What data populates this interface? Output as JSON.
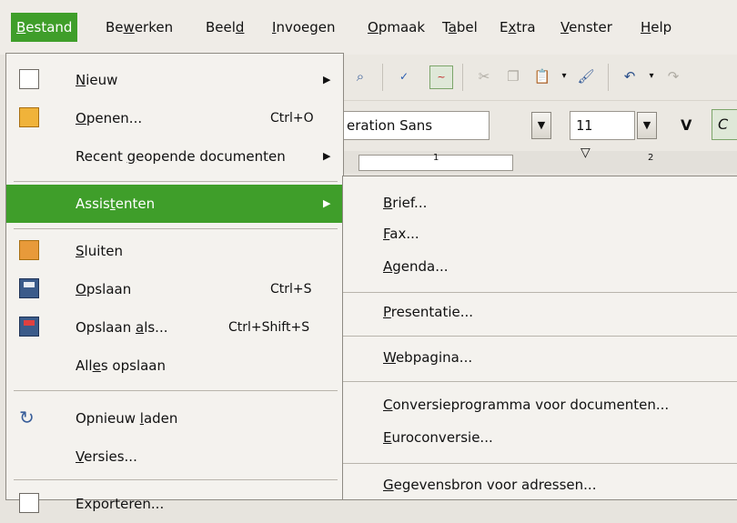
{
  "menubar": {
    "items": [
      {
        "label": "Bestand"
      },
      {
        "label": "Bewerken"
      },
      {
        "label": "Beeld"
      },
      {
        "label": "Invoegen"
      },
      {
        "label": "Opmaak"
      },
      {
        "label": "Tabel"
      },
      {
        "label": "Extra"
      },
      {
        "label": "Venster"
      },
      {
        "label": "Help"
      }
    ]
  },
  "toolbar": {
    "font_name": "eration Sans",
    "font_size": "11",
    "bold_label": "V",
    "italic_label": "C",
    "ruler_marks": [
      "1",
      "2"
    ]
  },
  "file_menu": {
    "items": [
      {
        "label": "Nieuw",
        "shortcut": "",
        "icon": "new-document-icon"
      },
      {
        "label": "Openen...",
        "shortcut": "Ctrl+O",
        "icon": "open-folder-icon"
      },
      {
        "label": "Recent geopende documenten",
        "shortcut": "",
        "icon": ""
      },
      {
        "label": "Assistenten",
        "shortcut": "",
        "icon": ""
      },
      {
        "label": "Sluiten",
        "shortcut": "",
        "icon": "close-document-icon"
      },
      {
        "label": "Opslaan",
        "shortcut": "Ctrl+S",
        "icon": "save-icon"
      },
      {
        "label": "Opslaan als...",
        "shortcut": "Ctrl+Shift+S",
        "icon": "save-as-icon"
      },
      {
        "label": "Alles opslaan",
        "shortcut": "",
        "icon": ""
      },
      {
        "label": "Opnieuw laden",
        "shortcut": "",
        "icon": "reload-icon"
      },
      {
        "label": "Versies...",
        "shortcut": "",
        "icon": ""
      },
      {
        "label": "Exporteren...",
        "shortcut": "",
        "icon": "export-icon"
      }
    ]
  },
  "wizards_submenu": {
    "items": [
      {
        "label": "Brief..."
      },
      {
        "label": "Fax..."
      },
      {
        "label": "Agenda..."
      },
      {
        "label": "Presentatie..."
      },
      {
        "label": "Webpagina..."
      },
      {
        "label": "Conversieprogramma voor documenten..."
      },
      {
        "label": "Euroconversie..."
      },
      {
        "label": "Gegevensbron voor adressen..."
      }
    ]
  },
  "colors": {
    "highlight": "#3f9e2a",
    "menu_bg": "#f4f2ee"
  }
}
